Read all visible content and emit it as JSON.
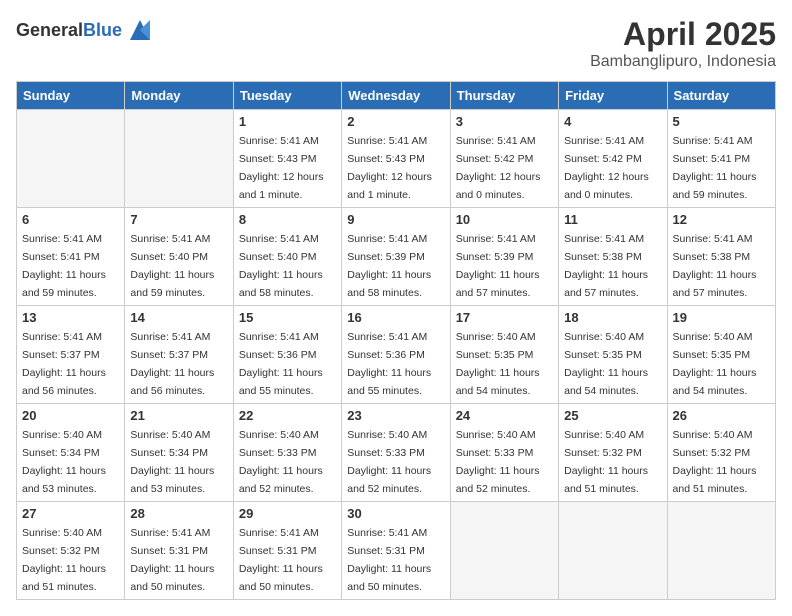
{
  "header": {
    "logo_general": "General",
    "logo_blue": "Blue",
    "month": "April 2025",
    "location": "Bambanglipuro, Indonesia"
  },
  "weekdays": [
    "Sunday",
    "Monday",
    "Tuesday",
    "Wednesday",
    "Thursday",
    "Friday",
    "Saturday"
  ],
  "weeks": [
    [
      {
        "day": "",
        "detail": ""
      },
      {
        "day": "",
        "detail": ""
      },
      {
        "day": "1",
        "detail": "Sunrise: 5:41 AM\nSunset: 5:43 PM\nDaylight: 12 hours\nand 1 minute."
      },
      {
        "day": "2",
        "detail": "Sunrise: 5:41 AM\nSunset: 5:43 PM\nDaylight: 12 hours\nand 1 minute."
      },
      {
        "day": "3",
        "detail": "Sunrise: 5:41 AM\nSunset: 5:42 PM\nDaylight: 12 hours\nand 0 minutes."
      },
      {
        "day": "4",
        "detail": "Sunrise: 5:41 AM\nSunset: 5:42 PM\nDaylight: 12 hours\nand 0 minutes."
      },
      {
        "day": "5",
        "detail": "Sunrise: 5:41 AM\nSunset: 5:41 PM\nDaylight: 11 hours\nand 59 minutes."
      }
    ],
    [
      {
        "day": "6",
        "detail": "Sunrise: 5:41 AM\nSunset: 5:41 PM\nDaylight: 11 hours\nand 59 minutes."
      },
      {
        "day": "7",
        "detail": "Sunrise: 5:41 AM\nSunset: 5:40 PM\nDaylight: 11 hours\nand 59 minutes."
      },
      {
        "day": "8",
        "detail": "Sunrise: 5:41 AM\nSunset: 5:40 PM\nDaylight: 11 hours\nand 58 minutes."
      },
      {
        "day": "9",
        "detail": "Sunrise: 5:41 AM\nSunset: 5:39 PM\nDaylight: 11 hours\nand 58 minutes."
      },
      {
        "day": "10",
        "detail": "Sunrise: 5:41 AM\nSunset: 5:39 PM\nDaylight: 11 hours\nand 57 minutes."
      },
      {
        "day": "11",
        "detail": "Sunrise: 5:41 AM\nSunset: 5:38 PM\nDaylight: 11 hours\nand 57 minutes."
      },
      {
        "day": "12",
        "detail": "Sunrise: 5:41 AM\nSunset: 5:38 PM\nDaylight: 11 hours\nand 57 minutes."
      }
    ],
    [
      {
        "day": "13",
        "detail": "Sunrise: 5:41 AM\nSunset: 5:37 PM\nDaylight: 11 hours\nand 56 minutes."
      },
      {
        "day": "14",
        "detail": "Sunrise: 5:41 AM\nSunset: 5:37 PM\nDaylight: 11 hours\nand 56 minutes."
      },
      {
        "day": "15",
        "detail": "Sunrise: 5:41 AM\nSunset: 5:36 PM\nDaylight: 11 hours\nand 55 minutes."
      },
      {
        "day": "16",
        "detail": "Sunrise: 5:41 AM\nSunset: 5:36 PM\nDaylight: 11 hours\nand 55 minutes."
      },
      {
        "day": "17",
        "detail": "Sunrise: 5:40 AM\nSunset: 5:35 PM\nDaylight: 11 hours\nand 54 minutes."
      },
      {
        "day": "18",
        "detail": "Sunrise: 5:40 AM\nSunset: 5:35 PM\nDaylight: 11 hours\nand 54 minutes."
      },
      {
        "day": "19",
        "detail": "Sunrise: 5:40 AM\nSunset: 5:35 PM\nDaylight: 11 hours\nand 54 minutes."
      }
    ],
    [
      {
        "day": "20",
        "detail": "Sunrise: 5:40 AM\nSunset: 5:34 PM\nDaylight: 11 hours\nand 53 minutes."
      },
      {
        "day": "21",
        "detail": "Sunrise: 5:40 AM\nSunset: 5:34 PM\nDaylight: 11 hours\nand 53 minutes."
      },
      {
        "day": "22",
        "detail": "Sunrise: 5:40 AM\nSunset: 5:33 PM\nDaylight: 11 hours\nand 52 minutes."
      },
      {
        "day": "23",
        "detail": "Sunrise: 5:40 AM\nSunset: 5:33 PM\nDaylight: 11 hours\nand 52 minutes."
      },
      {
        "day": "24",
        "detail": "Sunrise: 5:40 AM\nSunset: 5:33 PM\nDaylight: 11 hours\nand 52 minutes."
      },
      {
        "day": "25",
        "detail": "Sunrise: 5:40 AM\nSunset: 5:32 PM\nDaylight: 11 hours\nand 51 minutes."
      },
      {
        "day": "26",
        "detail": "Sunrise: 5:40 AM\nSunset: 5:32 PM\nDaylight: 11 hours\nand 51 minutes."
      }
    ],
    [
      {
        "day": "27",
        "detail": "Sunrise: 5:40 AM\nSunset: 5:32 PM\nDaylight: 11 hours\nand 51 minutes."
      },
      {
        "day": "28",
        "detail": "Sunrise: 5:41 AM\nSunset: 5:31 PM\nDaylight: 11 hours\nand 50 minutes."
      },
      {
        "day": "29",
        "detail": "Sunrise: 5:41 AM\nSunset: 5:31 PM\nDaylight: 11 hours\nand 50 minutes."
      },
      {
        "day": "30",
        "detail": "Sunrise: 5:41 AM\nSunset: 5:31 PM\nDaylight: 11 hours\nand 50 minutes."
      },
      {
        "day": "",
        "detail": ""
      },
      {
        "day": "",
        "detail": ""
      },
      {
        "day": "",
        "detail": ""
      }
    ]
  ]
}
